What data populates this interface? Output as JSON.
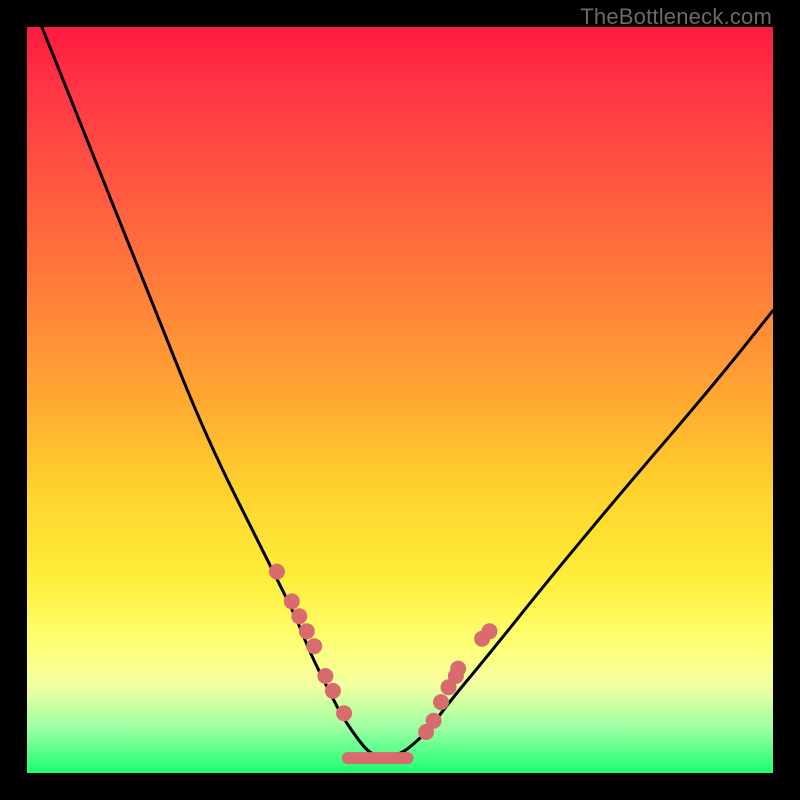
{
  "watermark": "TheBottleneck.com",
  "colors": {
    "dot": "#d86b6e",
    "floor": "#d86b6e",
    "curve": "#000000",
    "gradient_top": "#ff1a40",
    "gradient_bottom": "#1aff71"
  },
  "chart_data": {
    "type": "line",
    "title": "",
    "xlabel": "",
    "ylabel": "",
    "xlim": [
      0,
      100
    ],
    "ylim": [
      0,
      100
    ],
    "note": "Axes are unlabeled in the image; x/y units are percent of plot extent. y increases upward (0 = bottom green band, 100 = top red). The black curve is a deep V/well shape bottoming out near x≈46 at y≈2. Pink dots mark points along the lower part of both arms; a pink flat segment sits at the very bottom of the well.",
    "series": [
      {
        "name": "curve",
        "x": [
          2,
          6,
          10,
          14,
          18,
          22,
          26,
          30,
          33,
          36,
          38,
          40,
          42,
          44,
          46,
          48,
          50,
          52,
          54,
          57,
          62,
          70,
          80,
          92,
          100
        ],
        "y": [
          100,
          90,
          80,
          70,
          60,
          50,
          41,
          33,
          27,
          21,
          16,
          12,
          8,
          5,
          2.5,
          2.3,
          2.5,
          4,
          6,
          10,
          16,
          26,
          38,
          52,
          62
        ]
      }
    ],
    "markers": {
      "name": "dots",
      "x": [
        33.5,
        35.5,
        36.5,
        37.5,
        38.5,
        40,
        41,
        42.5,
        53.5,
        54.5,
        55.5,
        56.5,
        57.5,
        57.8,
        61,
        62
      ],
      "y": [
        27,
        23,
        21,
        19,
        17,
        13,
        11,
        8,
        5.5,
        7,
        9.5,
        11.5,
        13,
        14,
        18,
        19
      ]
    },
    "floor_segment": {
      "x_start": 43,
      "x_end": 51,
      "y": 2
    }
  }
}
